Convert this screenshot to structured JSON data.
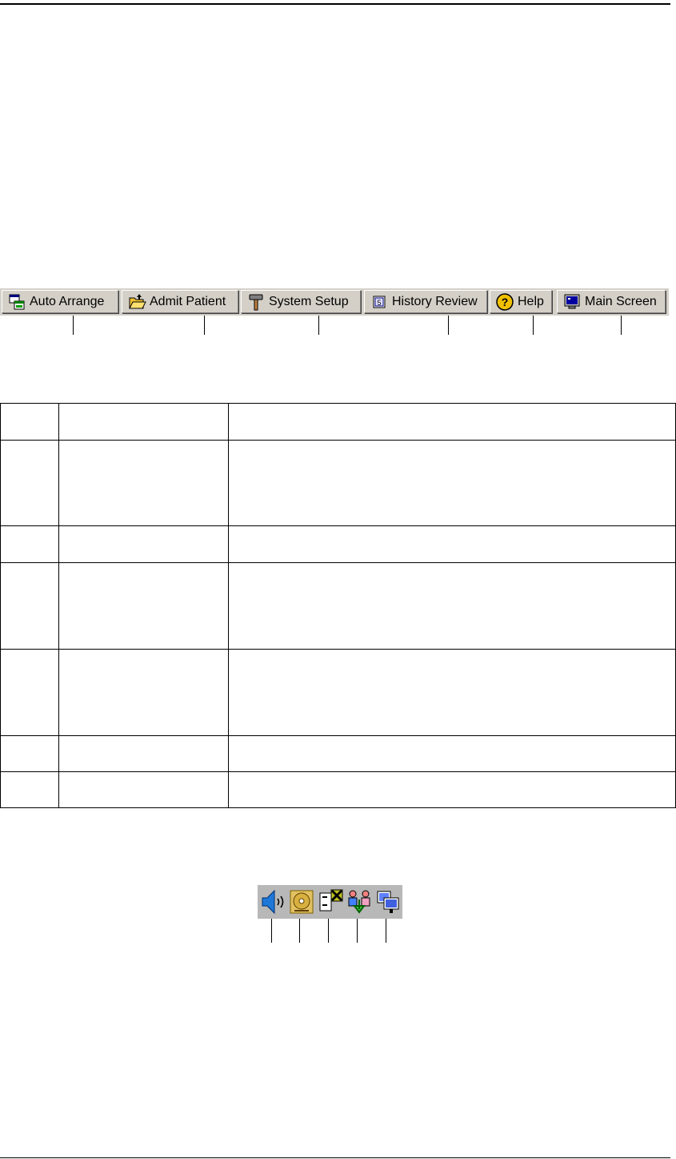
{
  "toolbar": {
    "buttons": [
      {
        "label": "Auto Arrange",
        "icon": "auto-arrange-icon"
      },
      {
        "label": "Admit Patient",
        "icon": "folder-icon"
      },
      {
        "label": "System Setup",
        "icon": "hammer-icon"
      },
      {
        "label": "History Review",
        "icon": "history-icon"
      },
      {
        "label": "Help",
        "icon": "help-icon"
      },
      {
        "label": "Main Screen",
        "icon": "monitor-icon"
      }
    ]
  },
  "table": {
    "rows": [
      {
        "num": "",
        "name": "",
        "desc": ""
      },
      {
        "num": "",
        "name": "",
        "desc": ""
      },
      {
        "num": "",
        "name": "",
        "desc": ""
      },
      {
        "num": "",
        "name": "",
        "desc": ""
      },
      {
        "num": "",
        "name": "",
        "desc": ""
      },
      {
        "num": "",
        "name": "",
        "desc": ""
      },
      {
        "num": "",
        "name": "",
        "desc": ""
      }
    ]
  },
  "status_icons": [
    "speaker-icon",
    "disk-icon",
    "network-disconnected-icon",
    "patient-transfer-icon",
    "screens-icon"
  ],
  "colors": {
    "toolbar_bg": "#d4d0c8",
    "strip_bg": "#b8b8b8"
  }
}
